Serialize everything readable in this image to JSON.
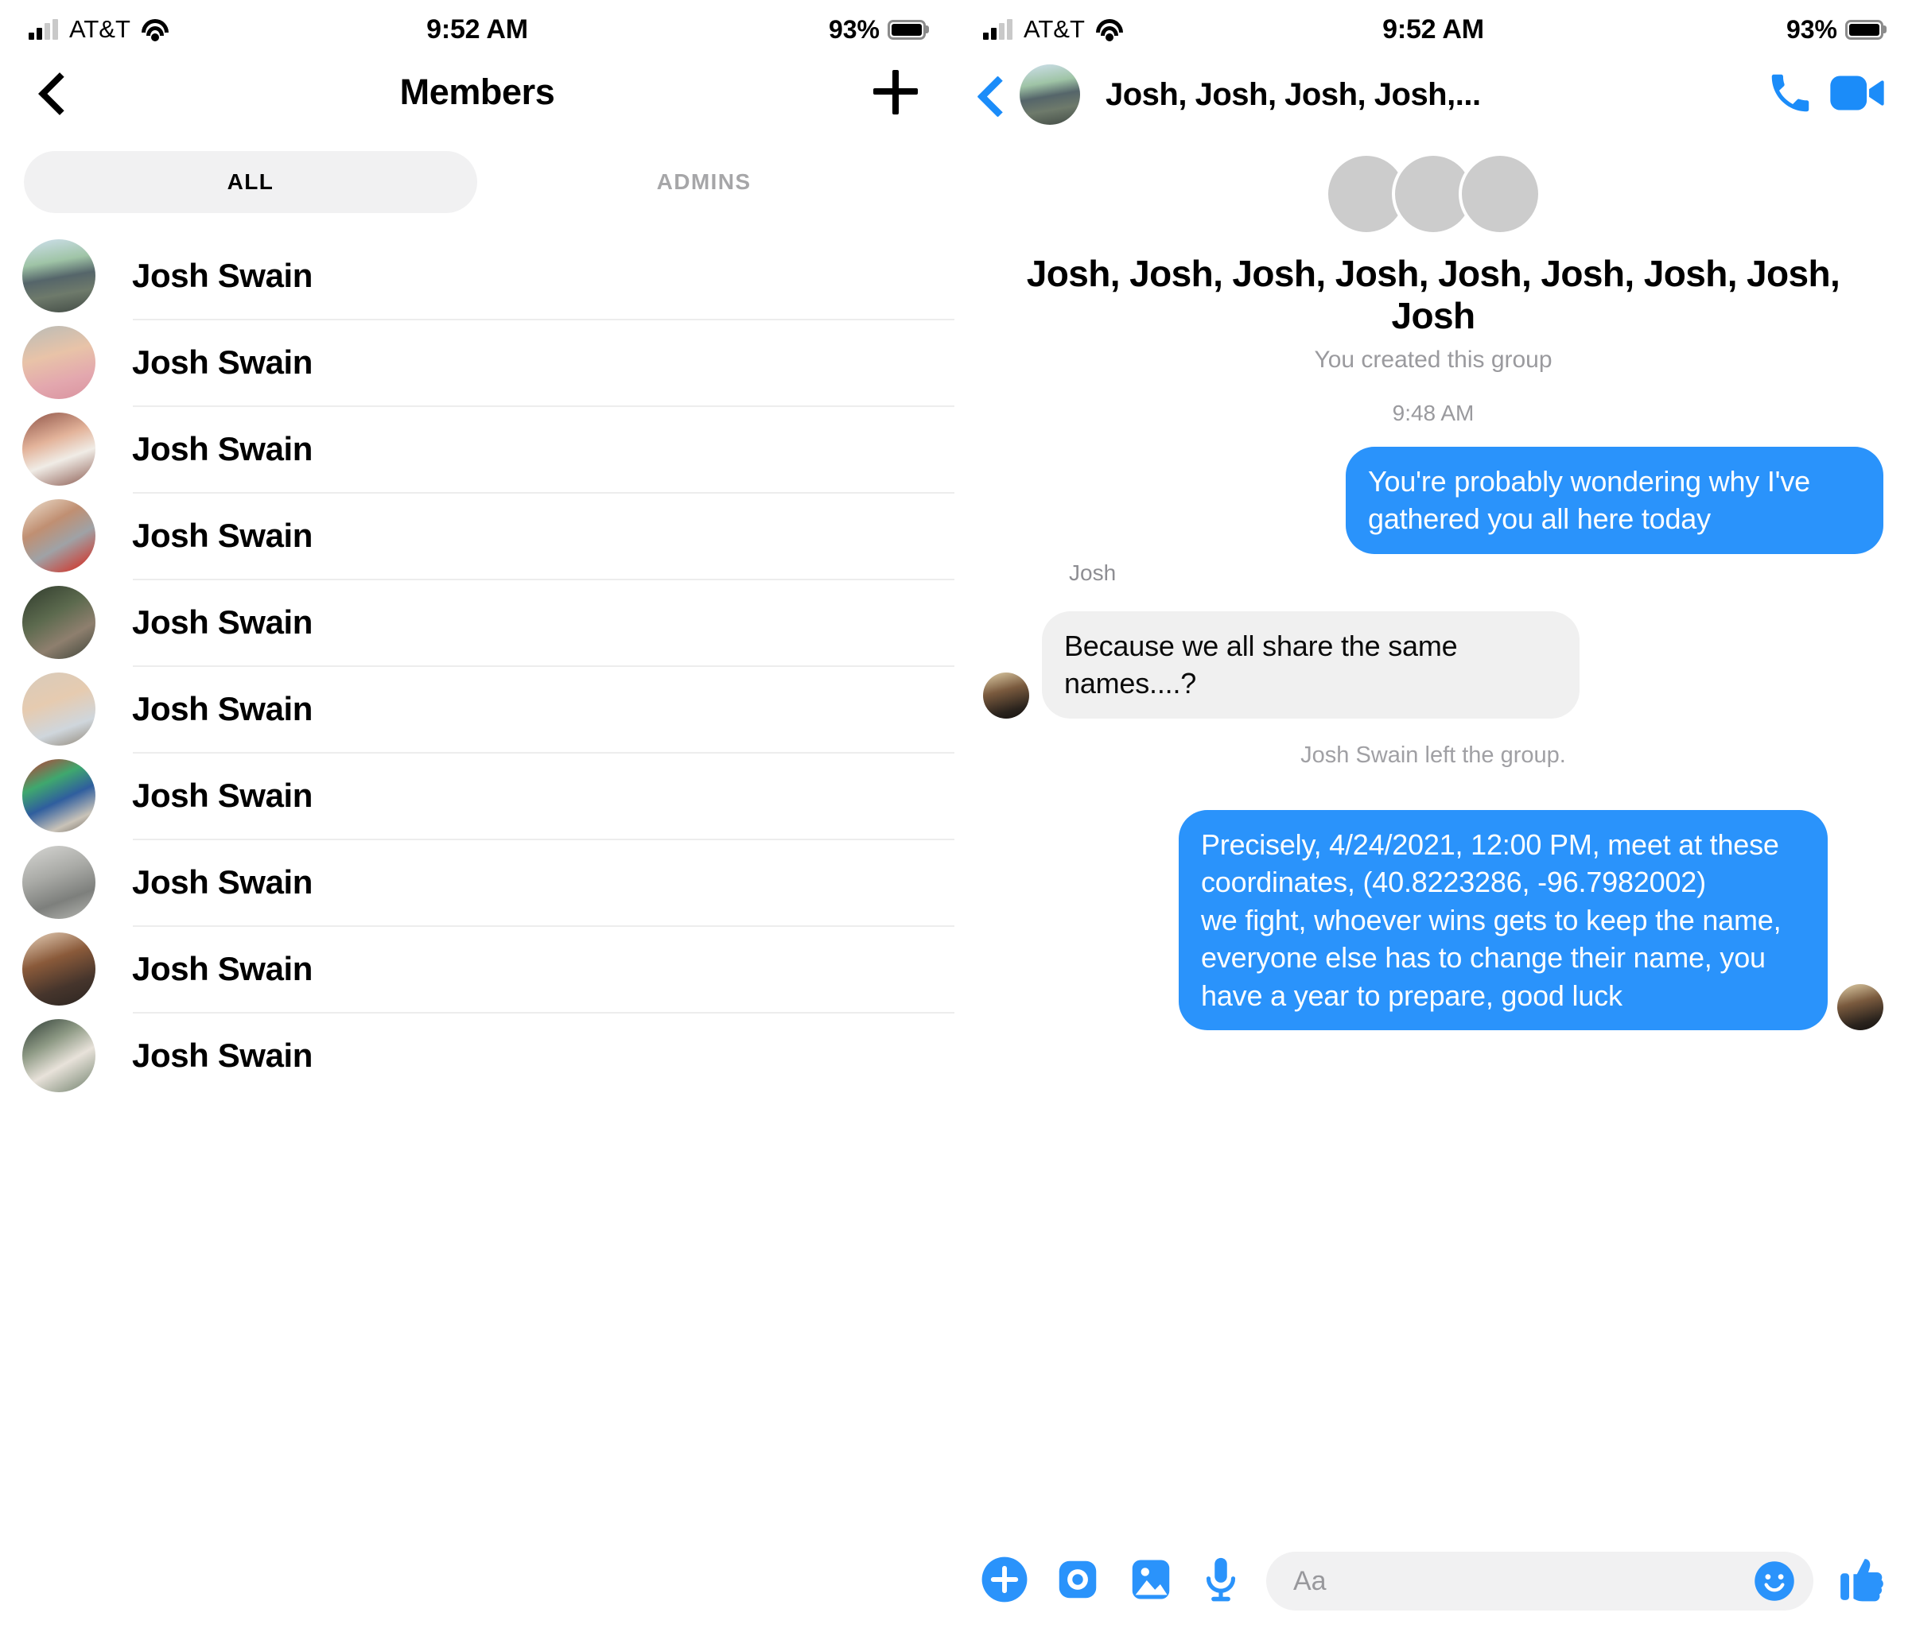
{
  "status_bar": {
    "carrier": "AT&T",
    "time": "9:52 AM",
    "battery_percent": "93%"
  },
  "left_panel": {
    "title": "Members",
    "back_label": "Back",
    "add_label": "Add member",
    "tabs": [
      {
        "label": "ALL",
        "active": true
      },
      {
        "label": "ADMINS",
        "active": false
      }
    ],
    "members": [
      {
        "name": "Josh Swain",
        "avatar": "ph-group1"
      },
      {
        "name": "Josh Swain",
        "avatar": "ph-man1"
      },
      {
        "name": "Josh Swain",
        "avatar": "ph-man2"
      },
      {
        "name": "Josh Swain",
        "avatar": "ph-kids"
      },
      {
        "name": "Josh Swain",
        "avatar": "ph-night"
      },
      {
        "name": "Josh Swain",
        "avatar": "ph-manglass"
      },
      {
        "name": "Josh Swain",
        "avatar": "ph-rock"
      },
      {
        "name": "Josh Swain",
        "avatar": "ph-stone"
      },
      {
        "name": "Josh Swain",
        "avatar": "ph-beard"
      },
      {
        "name": "Josh Swain",
        "avatar": "ph-fish"
      }
    ]
  },
  "right_panel": {
    "nav": {
      "title": "Josh, Josh, Josh, Josh,...",
      "back_label": "Back",
      "call_label": "Voice call",
      "video_label": "Video call"
    },
    "group_header": {
      "avatars": [
        "ph-group1",
        "ph-man1",
        "ph-man2"
      ],
      "name": "Josh, Josh, Josh, Josh, Josh, Josh, Josh, Josh, Josh",
      "subtitle": "You created this group"
    },
    "timestamp": "9:48 AM",
    "messages": [
      {
        "type": "outgoing",
        "text": "You're probably wondering why I've gathered you all here today"
      },
      {
        "type": "incoming",
        "sender": "Josh",
        "avatar": "ph-dark",
        "text": "Because we all share the same names....?"
      },
      {
        "type": "system",
        "text": "Josh Swain left the group."
      },
      {
        "type": "outgoing",
        "avatar": "ph-dark",
        "text": "Precisely, 4/24/2021, 12:00 PM, meet at these coordinates, (40.8223286, -96.7982002)\nwe fight, whoever wins gets to keep the name, everyone else has to change their name, you have a year to prepare, good luck"
      }
    ],
    "composer": {
      "placeholder": "Aa",
      "plus_label": "More actions",
      "camera_label": "Camera",
      "gallery_label": "Photo gallery",
      "mic_label": "Voice message",
      "emoji_label": "Emoji picker",
      "like_label": "Send like"
    }
  },
  "colors": {
    "accent_blue": "#2a93fb",
    "nav_blue": "#1b8cf9",
    "bubble_gray": "#f0f0f0",
    "muted_text": "#9a9a9e"
  }
}
